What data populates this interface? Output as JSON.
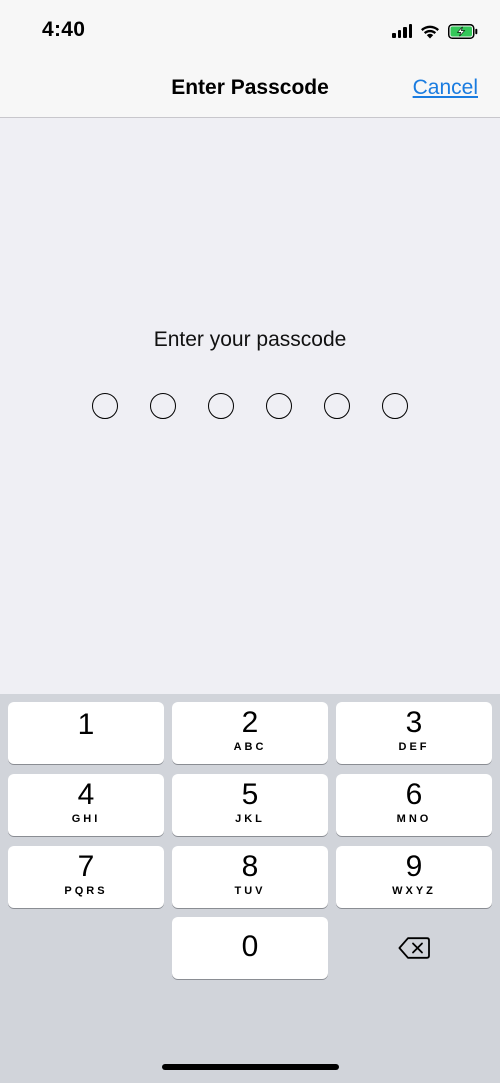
{
  "status_bar": {
    "time": "4:40",
    "battery_color": "#34c759"
  },
  "nav": {
    "title": "Enter Passcode",
    "cancel_label": "Cancel",
    "cancel_color": "#1a7ce0"
  },
  "prompt": "Enter your passcode",
  "passcode_length": 6,
  "keys": [
    {
      "digit": "1",
      "letters": ""
    },
    {
      "digit": "2",
      "letters": "ABC"
    },
    {
      "digit": "3",
      "letters": "DEF"
    },
    {
      "digit": "4",
      "letters": "GHI"
    },
    {
      "digit": "5",
      "letters": "JKL"
    },
    {
      "digit": "6",
      "letters": "MNO"
    },
    {
      "digit": "7",
      "letters": "PQRS"
    },
    {
      "digit": "8",
      "letters": "TUV"
    },
    {
      "digit": "9",
      "letters": "WXYZ"
    },
    {
      "digit": "0",
      "letters": ""
    }
  ],
  "icons": {
    "signal": "cellular-signal-icon",
    "wifi": "wifi-icon",
    "battery": "battery-charging-icon",
    "backspace": "backspace-icon"
  }
}
